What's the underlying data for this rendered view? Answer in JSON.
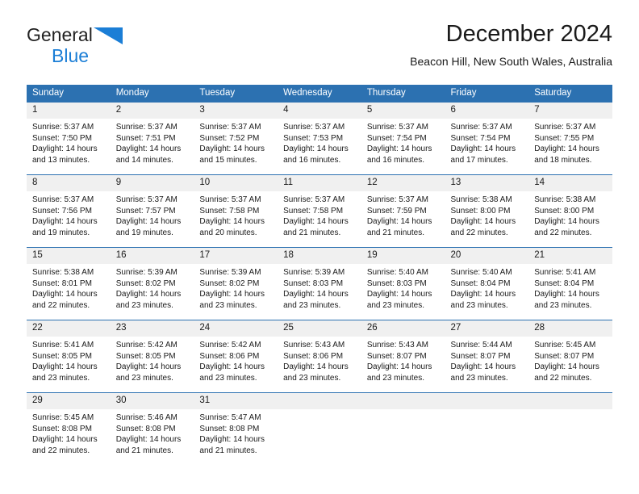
{
  "brand": {
    "name_top": "General",
    "name_bottom": "Blue",
    "triangle_color": "#1b7ed6"
  },
  "header": {
    "title": "December 2024",
    "subtitle": "Beacon Hill, New South Wales, Australia"
  },
  "theme": {
    "header_blue": "#2c71b1",
    "daynum_gray": "#f0f0f0",
    "text": "#1a1a1a"
  },
  "weekdays": [
    "Sunday",
    "Monday",
    "Tuesday",
    "Wednesday",
    "Thursday",
    "Friday",
    "Saturday"
  ],
  "weeks": [
    [
      {
        "day": "1",
        "sunrise": "Sunrise: 5:37 AM",
        "sunset": "Sunset: 7:50 PM",
        "daylight1": "Daylight: 14 hours",
        "daylight2": "and 13 minutes."
      },
      {
        "day": "2",
        "sunrise": "Sunrise: 5:37 AM",
        "sunset": "Sunset: 7:51 PM",
        "daylight1": "Daylight: 14 hours",
        "daylight2": "and 14 minutes."
      },
      {
        "day": "3",
        "sunrise": "Sunrise: 5:37 AM",
        "sunset": "Sunset: 7:52 PM",
        "daylight1": "Daylight: 14 hours",
        "daylight2": "and 15 minutes."
      },
      {
        "day": "4",
        "sunrise": "Sunrise: 5:37 AM",
        "sunset": "Sunset: 7:53 PM",
        "daylight1": "Daylight: 14 hours",
        "daylight2": "and 16 minutes."
      },
      {
        "day": "5",
        "sunrise": "Sunrise: 5:37 AM",
        "sunset": "Sunset: 7:54 PM",
        "daylight1": "Daylight: 14 hours",
        "daylight2": "and 16 minutes."
      },
      {
        "day": "6",
        "sunrise": "Sunrise: 5:37 AM",
        "sunset": "Sunset: 7:54 PM",
        "daylight1": "Daylight: 14 hours",
        "daylight2": "and 17 minutes."
      },
      {
        "day": "7",
        "sunrise": "Sunrise: 5:37 AM",
        "sunset": "Sunset: 7:55 PM",
        "daylight1": "Daylight: 14 hours",
        "daylight2": "and 18 minutes."
      }
    ],
    [
      {
        "day": "8",
        "sunrise": "Sunrise: 5:37 AM",
        "sunset": "Sunset: 7:56 PM",
        "daylight1": "Daylight: 14 hours",
        "daylight2": "and 19 minutes."
      },
      {
        "day": "9",
        "sunrise": "Sunrise: 5:37 AM",
        "sunset": "Sunset: 7:57 PM",
        "daylight1": "Daylight: 14 hours",
        "daylight2": "and 19 minutes."
      },
      {
        "day": "10",
        "sunrise": "Sunrise: 5:37 AM",
        "sunset": "Sunset: 7:58 PM",
        "daylight1": "Daylight: 14 hours",
        "daylight2": "and 20 minutes."
      },
      {
        "day": "11",
        "sunrise": "Sunrise: 5:37 AM",
        "sunset": "Sunset: 7:58 PM",
        "daylight1": "Daylight: 14 hours",
        "daylight2": "and 21 minutes."
      },
      {
        "day": "12",
        "sunrise": "Sunrise: 5:37 AM",
        "sunset": "Sunset: 7:59 PM",
        "daylight1": "Daylight: 14 hours",
        "daylight2": "and 21 minutes."
      },
      {
        "day": "13",
        "sunrise": "Sunrise: 5:38 AM",
        "sunset": "Sunset: 8:00 PM",
        "daylight1": "Daylight: 14 hours",
        "daylight2": "and 22 minutes."
      },
      {
        "day": "14",
        "sunrise": "Sunrise: 5:38 AM",
        "sunset": "Sunset: 8:00 PM",
        "daylight1": "Daylight: 14 hours",
        "daylight2": "and 22 minutes."
      }
    ],
    [
      {
        "day": "15",
        "sunrise": "Sunrise: 5:38 AM",
        "sunset": "Sunset: 8:01 PM",
        "daylight1": "Daylight: 14 hours",
        "daylight2": "and 22 minutes."
      },
      {
        "day": "16",
        "sunrise": "Sunrise: 5:39 AM",
        "sunset": "Sunset: 8:02 PM",
        "daylight1": "Daylight: 14 hours",
        "daylight2": "and 23 minutes."
      },
      {
        "day": "17",
        "sunrise": "Sunrise: 5:39 AM",
        "sunset": "Sunset: 8:02 PM",
        "daylight1": "Daylight: 14 hours",
        "daylight2": "and 23 minutes."
      },
      {
        "day": "18",
        "sunrise": "Sunrise: 5:39 AM",
        "sunset": "Sunset: 8:03 PM",
        "daylight1": "Daylight: 14 hours",
        "daylight2": "and 23 minutes."
      },
      {
        "day": "19",
        "sunrise": "Sunrise: 5:40 AM",
        "sunset": "Sunset: 8:03 PM",
        "daylight1": "Daylight: 14 hours",
        "daylight2": "and 23 minutes."
      },
      {
        "day": "20",
        "sunrise": "Sunrise: 5:40 AM",
        "sunset": "Sunset: 8:04 PM",
        "daylight1": "Daylight: 14 hours",
        "daylight2": "and 23 minutes."
      },
      {
        "day": "21",
        "sunrise": "Sunrise: 5:41 AM",
        "sunset": "Sunset: 8:04 PM",
        "daylight1": "Daylight: 14 hours",
        "daylight2": "and 23 minutes."
      }
    ],
    [
      {
        "day": "22",
        "sunrise": "Sunrise: 5:41 AM",
        "sunset": "Sunset: 8:05 PM",
        "daylight1": "Daylight: 14 hours",
        "daylight2": "and 23 minutes."
      },
      {
        "day": "23",
        "sunrise": "Sunrise: 5:42 AM",
        "sunset": "Sunset: 8:05 PM",
        "daylight1": "Daylight: 14 hours",
        "daylight2": "and 23 minutes."
      },
      {
        "day": "24",
        "sunrise": "Sunrise: 5:42 AM",
        "sunset": "Sunset: 8:06 PM",
        "daylight1": "Daylight: 14 hours",
        "daylight2": "and 23 minutes."
      },
      {
        "day": "25",
        "sunrise": "Sunrise: 5:43 AM",
        "sunset": "Sunset: 8:06 PM",
        "daylight1": "Daylight: 14 hours",
        "daylight2": "and 23 minutes."
      },
      {
        "day": "26",
        "sunrise": "Sunrise: 5:43 AM",
        "sunset": "Sunset: 8:07 PM",
        "daylight1": "Daylight: 14 hours",
        "daylight2": "and 23 minutes."
      },
      {
        "day": "27",
        "sunrise": "Sunrise: 5:44 AM",
        "sunset": "Sunset: 8:07 PM",
        "daylight1": "Daylight: 14 hours",
        "daylight2": "and 23 minutes."
      },
      {
        "day": "28",
        "sunrise": "Sunrise: 5:45 AM",
        "sunset": "Sunset: 8:07 PM",
        "daylight1": "Daylight: 14 hours",
        "daylight2": "and 22 minutes."
      }
    ],
    [
      {
        "day": "29",
        "sunrise": "Sunrise: 5:45 AM",
        "sunset": "Sunset: 8:08 PM",
        "daylight1": "Daylight: 14 hours",
        "daylight2": "and 22 minutes."
      },
      {
        "day": "30",
        "sunrise": "Sunrise: 5:46 AM",
        "sunset": "Sunset: 8:08 PM",
        "daylight1": "Daylight: 14 hours",
        "daylight2": "and 21 minutes."
      },
      {
        "day": "31",
        "sunrise": "Sunrise: 5:47 AM",
        "sunset": "Sunset: 8:08 PM",
        "daylight1": "Daylight: 14 hours",
        "daylight2": "and 21 minutes."
      },
      {
        "day": "",
        "sunrise": "",
        "sunset": "",
        "daylight1": "",
        "daylight2": ""
      },
      {
        "day": "",
        "sunrise": "",
        "sunset": "",
        "daylight1": "",
        "daylight2": ""
      },
      {
        "day": "",
        "sunrise": "",
        "sunset": "",
        "daylight1": "",
        "daylight2": ""
      },
      {
        "day": "",
        "sunrise": "",
        "sunset": "",
        "daylight1": "",
        "daylight2": ""
      }
    ]
  ]
}
